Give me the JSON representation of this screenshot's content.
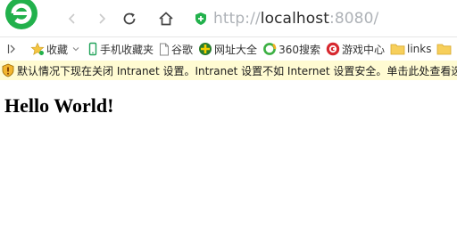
{
  "address_bar": {
    "scheme": "http://",
    "host": "localhost",
    "rest": ":8080/"
  },
  "bookmarks_bar": {
    "items": [
      {
        "label": "收藏",
        "icon": "star-icon"
      },
      {
        "label": "手机收藏夹",
        "icon": "phone-icon"
      },
      {
        "label": "谷歌",
        "icon": "page-icon"
      },
      {
        "label": "网址大全",
        "icon": "url-hub-icon"
      },
      {
        "label": "360搜索",
        "icon": "search-360-icon"
      },
      {
        "label": "游戏中心",
        "icon": "game-icon"
      },
      {
        "label": "links",
        "icon": "folder-icon"
      }
    ]
  },
  "infobar": {
    "text": "默认情况下现在关闭 Intranet 设置。Intranet 设置不如 Internet 设置安全。单击此处查看选项"
  },
  "page": {
    "heading": "Hello World!"
  },
  "colors": {
    "brand_green": "#22b14c",
    "infobar_bg": "#fffbd2",
    "url_muted": "#aeb2b7"
  }
}
